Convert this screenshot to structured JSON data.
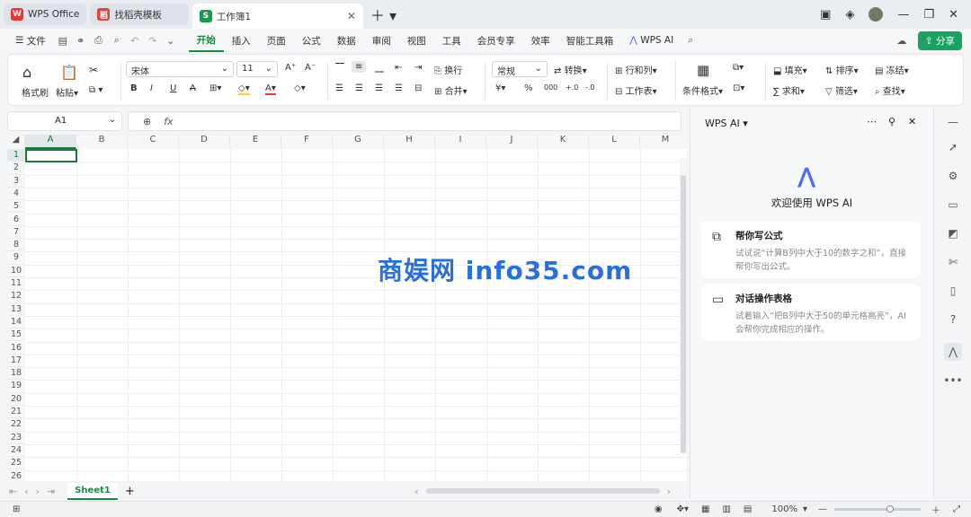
{
  "tabs": [
    {
      "label": "WPS Office",
      "icon": "wps-logo"
    },
    {
      "label": "找稻壳模板",
      "icon": "docer-logo"
    },
    {
      "label": "工作簿1",
      "icon": "sheet-logo"
    }
  ],
  "menu": {
    "file": "文件",
    "items": [
      "开始",
      "插入",
      "页面",
      "公式",
      "数据",
      "审阅",
      "视图",
      "工具",
      "会员专享",
      "效率",
      "智能工具箱"
    ],
    "active": "开始",
    "wps_ai": "WPS AI",
    "share": "分享"
  },
  "ribbon": {
    "format_painter": "格式刷",
    "paste": "粘贴",
    "font": "宋体",
    "font_size": "11",
    "wrap": "换行",
    "merge": "合并",
    "number_format": "常规",
    "convert": "转换",
    "row_col": "行和列",
    "worksheet": "工作表",
    "cond_format": "条件格式",
    "fill": "填充",
    "sort": "排序",
    "freeze": "冻结",
    "sum": "求和",
    "filter": "筛选",
    "find": "查找"
  },
  "formula": {
    "cell_ref": "A1",
    "fx": "fx"
  },
  "columns": [
    "A",
    "B",
    "C",
    "D",
    "E",
    "F",
    "G",
    "H",
    "I",
    "J",
    "K",
    "L",
    "M"
  ],
  "rows": [
    "1",
    "2",
    "3",
    "4",
    "5",
    "6",
    "7",
    "8",
    "9",
    "10",
    "11",
    "12",
    "13",
    "14",
    "15",
    "16",
    "17",
    "18",
    "19",
    "20",
    "21",
    "22",
    "23",
    "24",
    "25",
    "26"
  ],
  "sheet": {
    "tab": "Sheet1",
    "add": "+"
  },
  "status": {
    "zoom": "100%"
  },
  "ai": {
    "title": "WPS AI",
    "welcome": "欢迎使用 WPS AI",
    "cards": [
      {
        "title": "帮你写公式",
        "desc": "试试说“计算B列中大于10的数字之和”，直接帮你写出公式。",
        "icon": "formula-add-icon"
      },
      {
        "title": "对话操作表格",
        "desc": "试着输入“把B列中大于50的单元格高亮”，AI会帮你完成相应的操作。",
        "icon": "chat-table-icon"
      }
    ]
  },
  "watermark": "商娱网 info35.com",
  "colors": {
    "accent": "#1a8a3f",
    "share": "#1aa260",
    "watermark": "#2a6fe0"
  }
}
